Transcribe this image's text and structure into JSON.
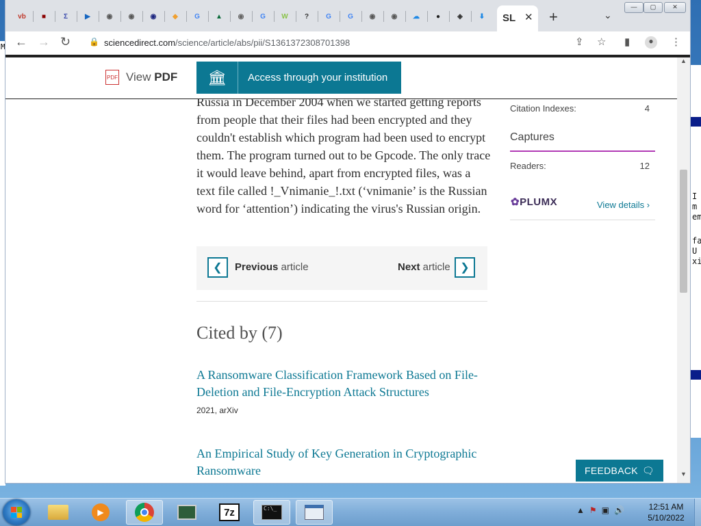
{
  "browser": {
    "active_tab_label": "SL",
    "url_host": "sciencedirect.com",
    "url_path": "/science/article/abs/pii/S1361372308701398",
    "tab_icons": [
      "vb",
      "■",
      "Σ",
      "▶",
      "◉",
      "◉",
      "◉",
      "◆",
      "G",
      "▲",
      "◉",
      "G",
      "W",
      "?",
      "G",
      "G",
      "◉",
      "◉",
      "☁",
      "●",
      "◈",
      "⬇"
    ]
  },
  "sticky": {
    "view_label": "View",
    "pdf_label": "PDF",
    "institution_label": "Access through your institution"
  },
  "article": {
    "paragraph": "Russia in December 2004 when we started getting reports from people that their files had been encrypted and they couldn't establish which program had been used to encrypt them. The program turned out to be Gpcode. The only trace it would leave behind, apart from encrypted files, was a text file called !_Vnimanie_!.txt (‘vnimanie’ is the Russian word for ‘attention’) indicating the virus's Russian origin."
  },
  "prevnext": {
    "prev_bold": "Previous",
    "prev_rest": " article",
    "next_bold": "Next",
    "next_rest": " article"
  },
  "cited": {
    "title": "Cited by (7)",
    "items": [
      {
        "title": "A Ransomware Classification Framework Based on File-Deletion and File-Encryption Attack Structures",
        "meta": "2021, arXiv"
      },
      {
        "title": "An Empirical Study of Key Generation in Cryptographic Ransomware",
        "meta": ""
      }
    ]
  },
  "metrics": {
    "citation_indexes_label": "Citation Indexes:",
    "citation_indexes_value": "4",
    "captures_label": "Captures",
    "readers_label": "Readers:",
    "readers_value": "12",
    "plumx_logo": "PLUMX",
    "view_details": "View details"
  },
  "feedback_label": "FEEDBACK",
  "taskbar": {
    "time": "12:51 AM",
    "date": "5/10/2022",
    "sevenzip_label": "7z"
  },
  "background_window": {
    "right_text": [
      "I",
      "m",
      "em",
      "fa",
      "U",
      "xi"
    ],
    "left_text": [
      "M"
    ]
  },
  "colors": {
    "accent": "#0c7893",
    "captures_line": "#b13ab5",
    "taskbar": "#7fadd9"
  }
}
